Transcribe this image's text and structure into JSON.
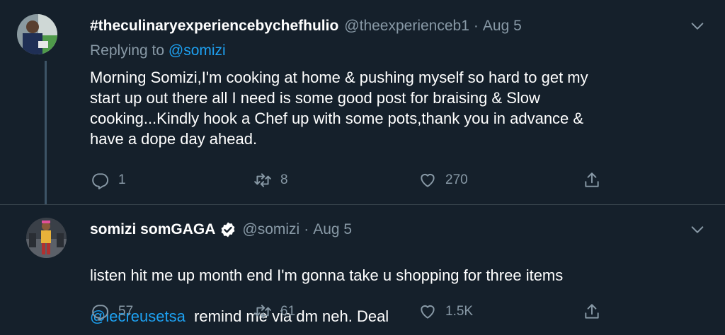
{
  "tweets": [
    {
      "author_name": "#theculinaryexperiencebychefhulio",
      "handle": "@theexperienceb1",
      "separator": "·",
      "date": "Aug 5",
      "replying_label": "Replying to",
      "replying_to": "@somizi",
      "text": "Morning Somizi,I'm cooking at home & pushing myself so hard to get my\nstart up out there all I need is some good post for braising & Slow\ncooking...Kindly hook a Chef up with some pots,thank you in advance &\nhave a dope day ahead.",
      "replies": "1",
      "retweets": "8",
      "likes": "270"
    },
    {
      "author_name": "somizi somGAGA",
      "handle": "@somizi",
      "separator": "·",
      "date": "Aug 5",
      "text_line1": "listen hit me up month end I'm gonna take u shopping for three items",
      "text_mention": "@lecreusetsa",
      "text_rest": "  remind me via dm neh. Deal",
      "replies": "57",
      "retweets": "61",
      "likes": "1.5K"
    }
  ],
  "colors": {
    "background": "#15202b",
    "text": "#ffffff",
    "muted": "#8899a6",
    "link": "#1da1f2",
    "divider": "#38444d"
  }
}
